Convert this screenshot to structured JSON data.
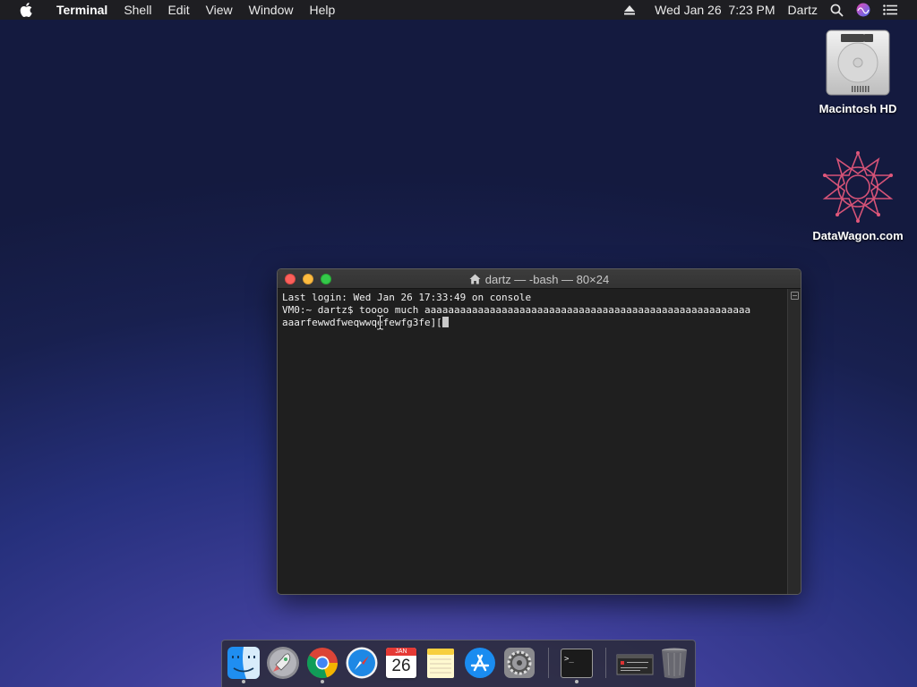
{
  "menubar": {
    "app_name": "Terminal",
    "menus": [
      "Shell",
      "Edit",
      "View",
      "Window",
      "Help"
    ],
    "datetime": "Wed Jan 26  7:23 PM",
    "user": "Dartz",
    "icons": [
      "apple-logo-icon",
      "eject-icon",
      "search-icon",
      "siri-icon",
      "notification-center-icon"
    ]
  },
  "desktop": {
    "icons": [
      {
        "label": "Macintosh HD",
        "icon": "hard-drive-icon"
      },
      {
        "label": "DataWagon.com",
        "icon": "datawagon-logo-icon"
      }
    ]
  },
  "terminal": {
    "title": "dartz — -bash — 80×24",
    "lines": [
      "Last login: Wed Jan 26 17:33:49 on console",
      "VM0:~ dartz$ toooo much aaaaaaaaaaaaaaaaaaaaaaaaaaaaaaaaaaaaaaaaaaaaaaaaaaaaaaa",
      "aaarfewwdfweqwwqefewfg3fe]["
    ]
  },
  "dock": {
    "items": [
      {
        "name": "finder",
        "icon": "finder-icon",
        "running": true
      },
      {
        "name": "launchpad",
        "icon": "launchpad-rocket-icon",
        "running": false
      },
      {
        "name": "chrome",
        "icon": "chrome-icon",
        "running": true
      },
      {
        "name": "safari",
        "icon": "safari-compass-icon",
        "running": false
      },
      {
        "name": "calendar",
        "icon": "calendar-icon",
        "running": false,
        "month": "JAN",
        "day": "26"
      },
      {
        "name": "notes",
        "icon": "notes-icon",
        "running": false
      },
      {
        "name": "app-store",
        "icon": "app-store-icon",
        "running": false
      },
      {
        "name": "system-preferences",
        "icon": "gear-icon",
        "running": false
      },
      {
        "name": "terminal",
        "icon": "terminal-icon",
        "running": true,
        "prompt": ">_"
      },
      {
        "name": "minimized-window",
        "icon": "minimized-window-icon",
        "running": false
      },
      {
        "name": "trash",
        "icon": "trash-icon",
        "running": false
      }
    ]
  },
  "colors": {
    "menubar_bg": "#1e1e22",
    "terminal_bg": "#1f1f1f",
    "close": "#fc605b",
    "minimize": "#fdbc40",
    "maximize": "#34c84a"
  }
}
